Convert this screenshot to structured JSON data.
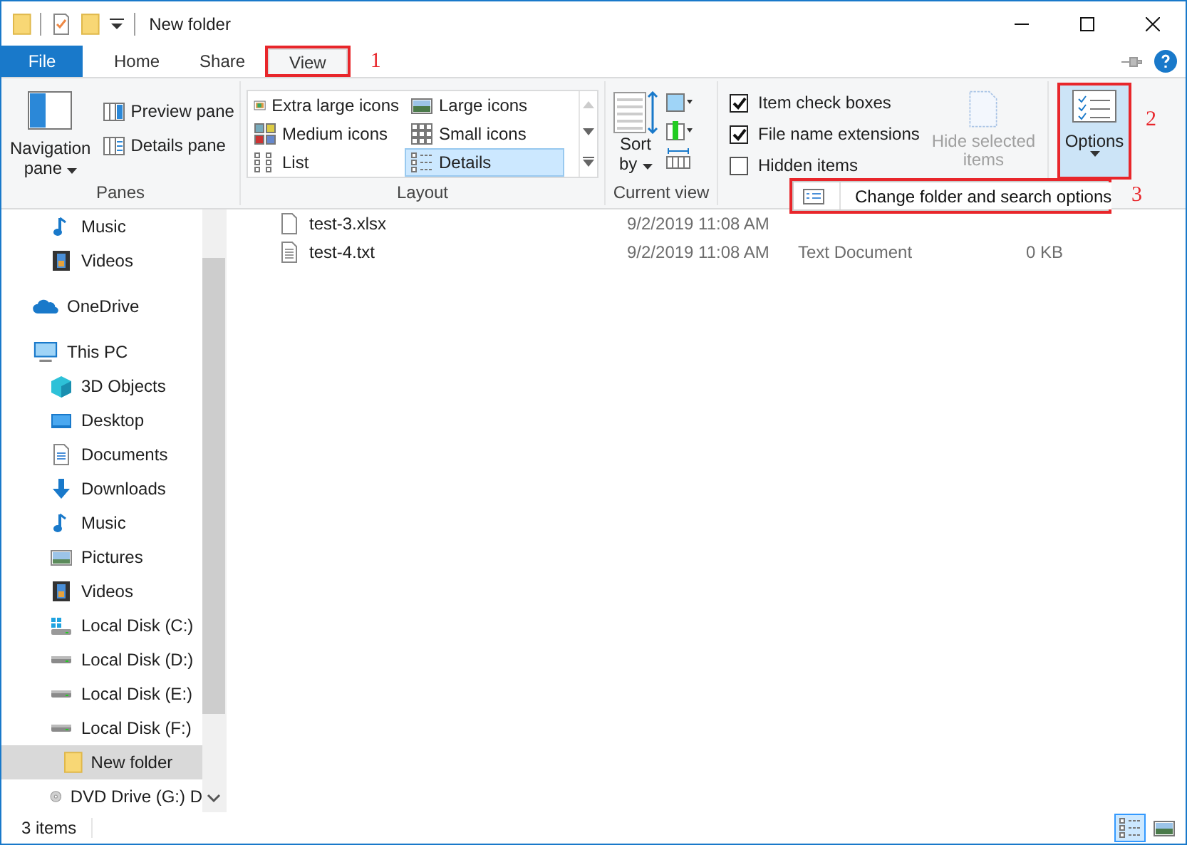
{
  "window": {
    "title": "New folder"
  },
  "tabs": [
    {
      "label": "File",
      "kind": "file",
      "selected": false
    },
    {
      "label": "Home",
      "kind": "tab",
      "selected": false
    },
    {
      "label": "Share",
      "kind": "tab",
      "selected": false
    },
    {
      "label": "View",
      "kind": "tab",
      "selected": true,
      "annotation": "1"
    }
  ],
  "ribbon": {
    "panes": {
      "title": "Panes",
      "navigation_pane": "Navigation pane",
      "buttons": [
        {
          "label": "Preview pane",
          "kind": "preview"
        },
        {
          "label": "Details pane",
          "kind": "details"
        }
      ]
    },
    "layout": {
      "title": "Layout",
      "items": [
        {
          "label": "Extra large icons",
          "kind": "xl",
          "selected": false
        },
        {
          "label": "Large icons",
          "kind": "large",
          "selected": false
        },
        {
          "label": "Medium icons",
          "kind": "medium",
          "selected": false
        },
        {
          "label": "Small icons",
          "kind": "small",
          "selected": false
        },
        {
          "label": "List",
          "kind": "list",
          "selected": false
        },
        {
          "label": "Details",
          "kind": "details",
          "selected": true
        }
      ]
    },
    "current_view": {
      "title": "Current view",
      "sort": "Sort by"
    },
    "show_hide": {
      "checkboxes": [
        {
          "label": "Item check boxes",
          "checked": true
        },
        {
          "label": "File name extensions",
          "checked": true
        },
        {
          "label": "Hidden items",
          "checked": false
        }
      ],
      "hide_selected": {
        "label": "Hide selected items",
        "disabled": true
      }
    },
    "options": {
      "label": "Options",
      "selected": true,
      "annotation": "2"
    }
  },
  "options_menu": {
    "items": [
      {
        "label": "Change folder and search options"
      }
    ],
    "annotation": "3"
  },
  "navigation": {
    "partial": [
      {
        "label": "Music",
        "kind": "music",
        "selected": false
      },
      {
        "label": "Videos",
        "kind": "video",
        "selected": false
      }
    ],
    "items": [
      {
        "label": "OneDrive",
        "kind": "cloud",
        "selected": false
      },
      {
        "label": "This PC",
        "kind": "pc",
        "selected": false,
        "children": [
          {
            "label": "3D Objects",
            "kind": "cube",
            "selected": false
          },
          {
            "label": "Desktop",
            "kind": "desktop",
            "selected": false
          },
          {
            "label": "Documents",
            "kind": "document",
            "selected": false
          },
          {
            "label": "Downloads",
            "kind": "download",
            "selected": false
          },
          {
            "label": "Music",
            "kind": "music",
            "selected": false
          },
          {
            "label": "Pictures",
            "kind": "pictures",
            "selected": false
          },
          {
            "label": "Videos",
            "kind": "video",
            "selected": false
          },
          {
            "label": "Local Disk (C:)",
            "kind": "systemdrive",
            "selected": false
          },
          {
            "label": "Local Disk (D:)",
            "kind": "drive",
            "selected": false
          },
          {
            "label": "Local Disk (E:)",
            "kind": "drive",
            "selected": false
          },
          {
            "label": "Local Disk (F:)",
            "kind": "drive",
            "selected": false,
            "children": [
              {
                "label": "New folder",
                "kind": "folder",
                "selected": true
              }
            ]
          },
          {
            "label": "DVD Drive (G:) D",
            "kind": "dvd",
            "selected": false
          }
        ]
      }
    ]
  },
  "files": [
    {
      "name": "test-3.xlsx",
      "date": "9/2/2019 11:08 AM",
      "kind": "blank"
    },
    {
      "name": "test-4.txt",
      "date": "9/2/2019 11:08 AM",
      "type": "Text Document",
      "size": "0 KB",
      "kind": "text"
    }
  ],
  "status_bar": {
    "count": "3 items",
    "views": [
      {
        "kind": "details",
        "selected": true
      },
      {
        "kind": "large",
        "selected": false
      }
    ]
  }
}
